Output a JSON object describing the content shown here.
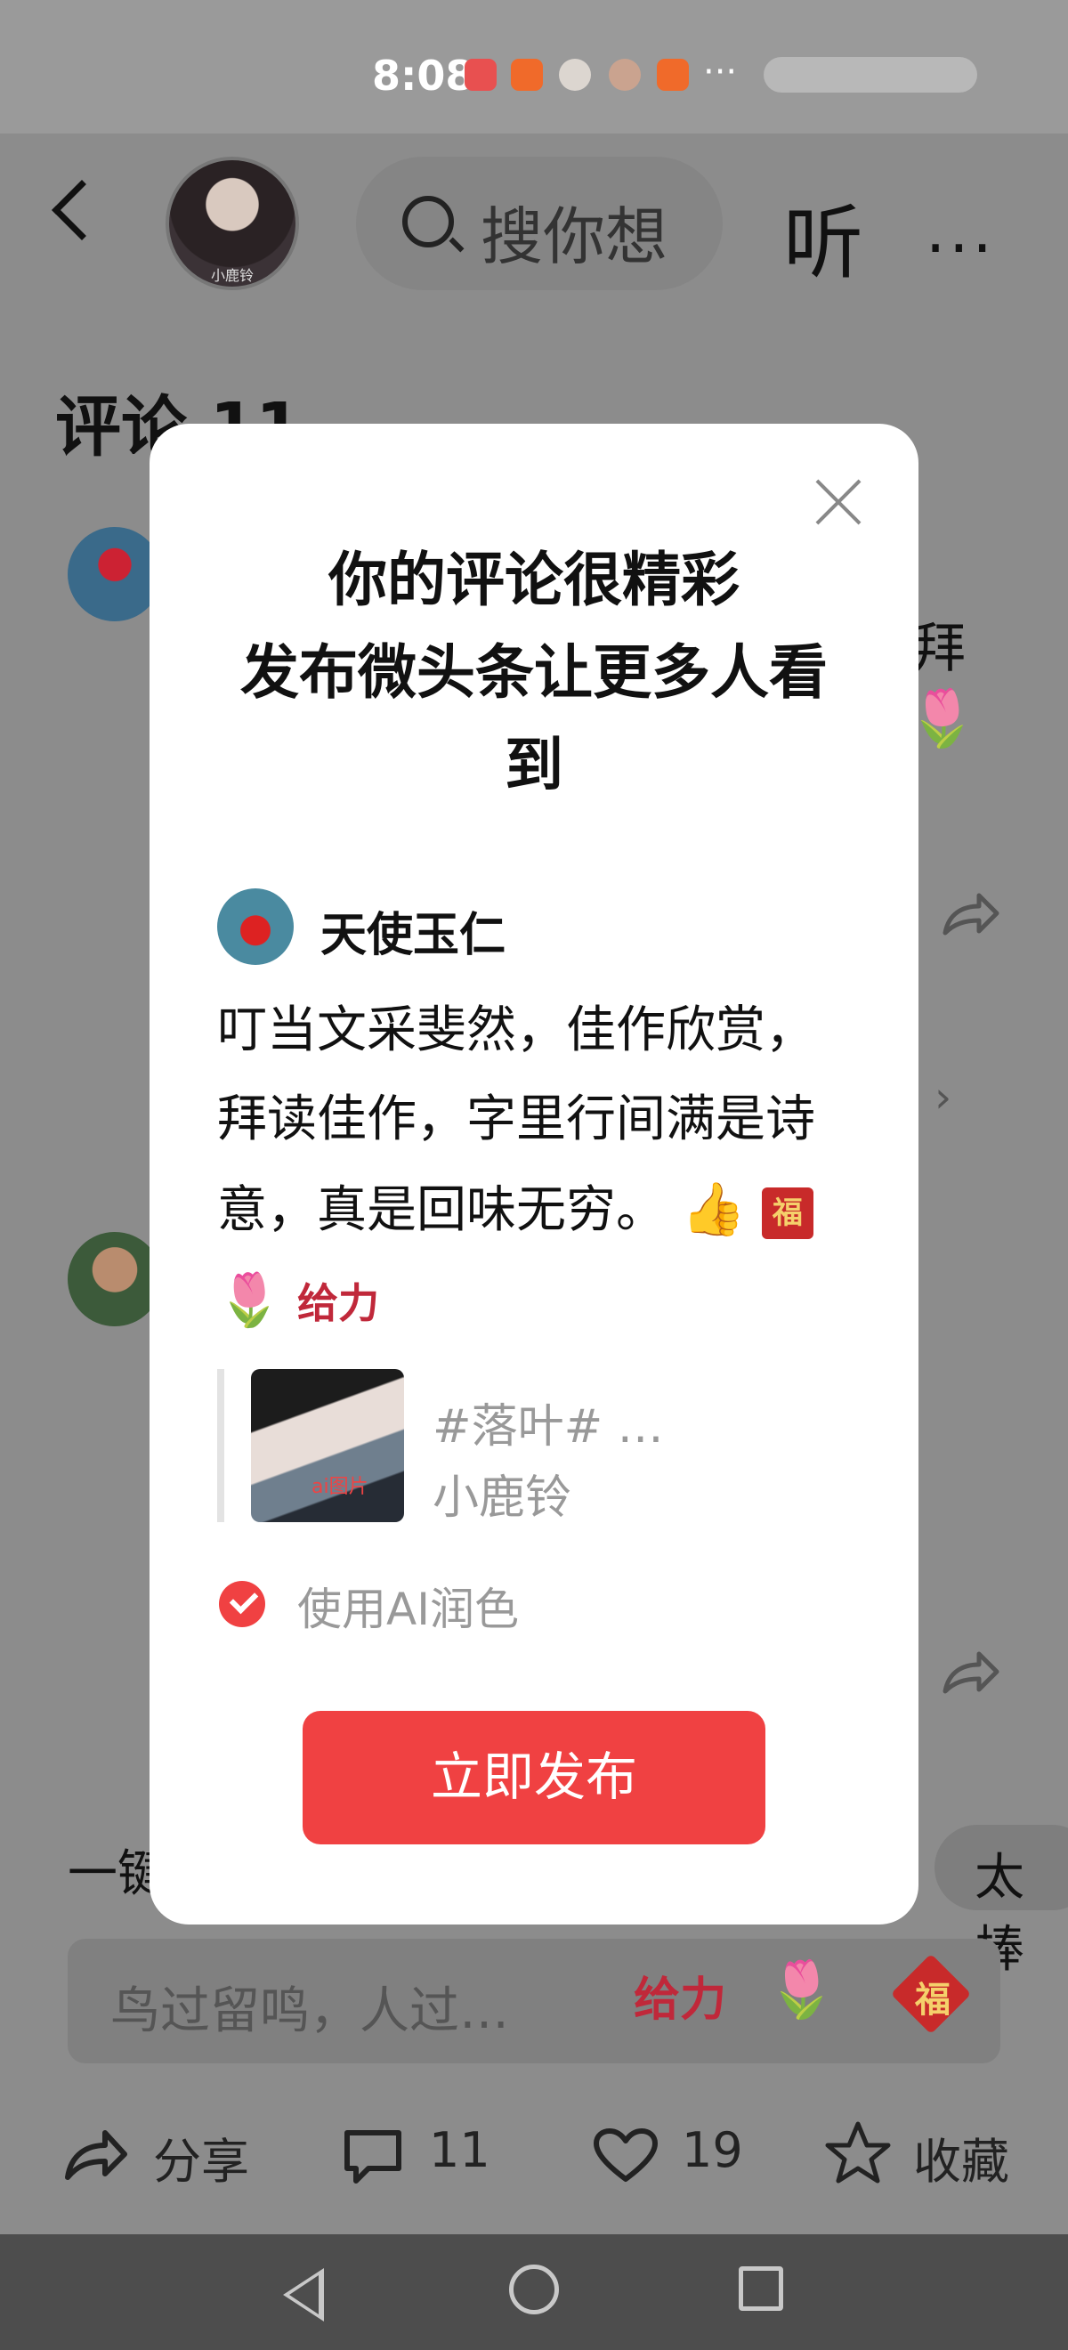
{
  "status_bar": {
    "time": "8:08",
    "overflow": "···"
  },
  "header": {
    "search_placeholder": "搜你想",
    "listen_label": "听",
    "more_label": "···",
    "avatar_tag": "小鹿铃"
  },
  "comments_title": "评论 11",
  "background": {
    "partial_text": "拜",
    "one_click": "一键",
    "great_chip": "太棒",
    "chevron": "›"
  },
  "input_bar": {
    "placeholder": "鸟过留鸣，人过…",
    "emojis": [
      "给力",
      "🌷",
      "福"
    ]
  },
  "bottom_bar": {
    "share_label": "分享",
    "comment_count": "11",
    "like_count": "19",
    "collect_label": "收藏"
  },
  "modal": {
    "title_line1": "你的评论很精彩",
    "title_line2": "发布微头条让更多人看",
    "title_line3": "到",
    "user_name": "天使玉仁",
    "comment_text": "叮当文采斐然，佳作欣赏，拜读佳作，字里行间满是诗意，真是回味无穷。",
    "emojis": [
      "👍",
      "福",
      "🌷",
      "给力"
    ],
    "quote_title": "#落叶# …",
    "quote_author": "小鹿铃",
    "thumb_tag": "ai图片",
    "ai_polish_label": "使用AI润色",
    "ai_polish_checked": true,
    "publish_label": "立即发布"
  },
  "colors": {
    "accent": "#f04142",
    "overlay": "#8c8c8c",
    "muted_text": "#999999"
  }
}
